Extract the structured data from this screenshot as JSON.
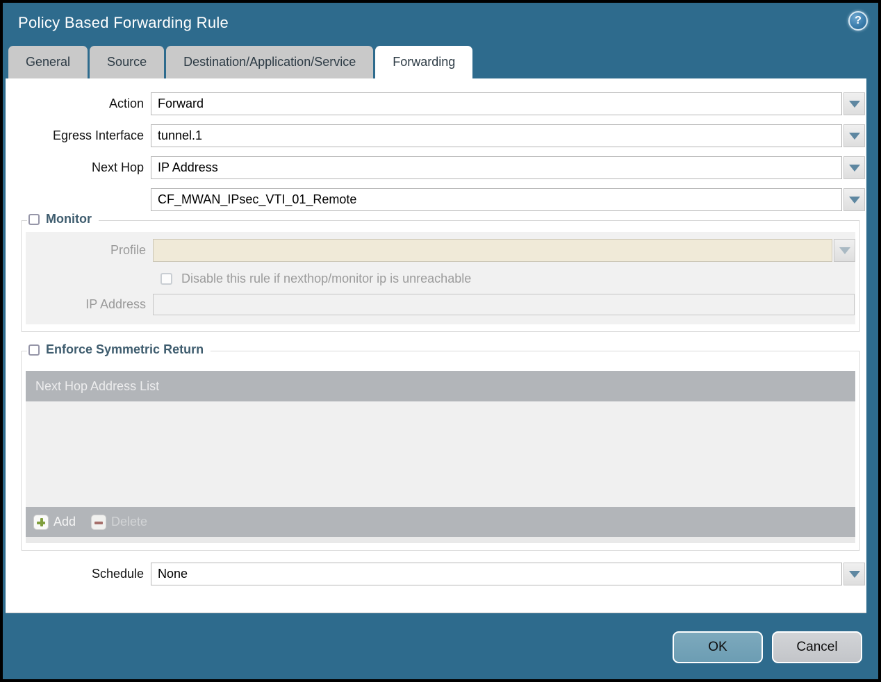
{
  "window": {
    "title": "Policy Based Forwarding Rule",
    "help_glyph": "?"
  },
  "tabs": [
    {
      "label": "General",
      "active": false
    },
    {
      "label": "Source",
      "active": false
    },
    {
      "label": "Destination/Application/Service",
      "active": false
    },
    {
      "label": "Forwarding",
      "active": true
    }
  ],
  "form": {
    "action": {
      "label": "Action",
      "value": "Forward"
    },
    "egress_interface": {
      "label": "Egress Interface",
      "value": "tunnel.1"
    },
    "next_hop": {
      "label": "Next Hop",
      "value": "IP Address"
    },
    "next_hop_address": {
      "value": "CF_MWAN_IPsec_VTI_01_Remote"
    },
    "schedule": {
      "label": "Schedule",
      "value": "None"
    }
  },
  "monitor": {
    "legend": "Monitor",
    "checked": false,
    "profile": {
      "label": "Profile",
      "value": ""
    },
    "disable_rule": {
      "label": "Disable this rule if nexthop/monitor ip is unreachable",
      "checked": false
    },
    "ip_address": {
      "label": "IP Address",
      "value": ""
    }
  },
  "symmetric_return": {
    "legend": "Enforce Symmetric Return",
    "checked": false,
    "table_header": "Next Hop Address List",
    "rows": [],
    "add_label": "Add",
    "delete_label": "Delete"
  },
  "footer": {
    "ok_label": "OK",
    "cancel_label": "Cancel"
  },
  "icons": {
    "help": "help-icon",
    "dropdown": "chevron-down-icon",
    "add": "plus-icon",
    "delete": "minus-icon"
  },
  "colors": {
    "dialog_background": "#2e6b8d",
    "tab_inactive": "#c9c9c9",
    "tab_active": "#ffffff",
    "legend_text": "#3e5c6e",
    "disabled_field_cream": "#f0ead8",
    "table_header_grey": "#b2b5b9",
    "dropdown_arrow": "#5e87a1",
    "ok_button": "#6c9db3",
    "cancel_button": "#c3c5c9",
    "add_plus_green": "#7f9e3c",
    "delete_minus_red": "#a66f6b"
  }
}
